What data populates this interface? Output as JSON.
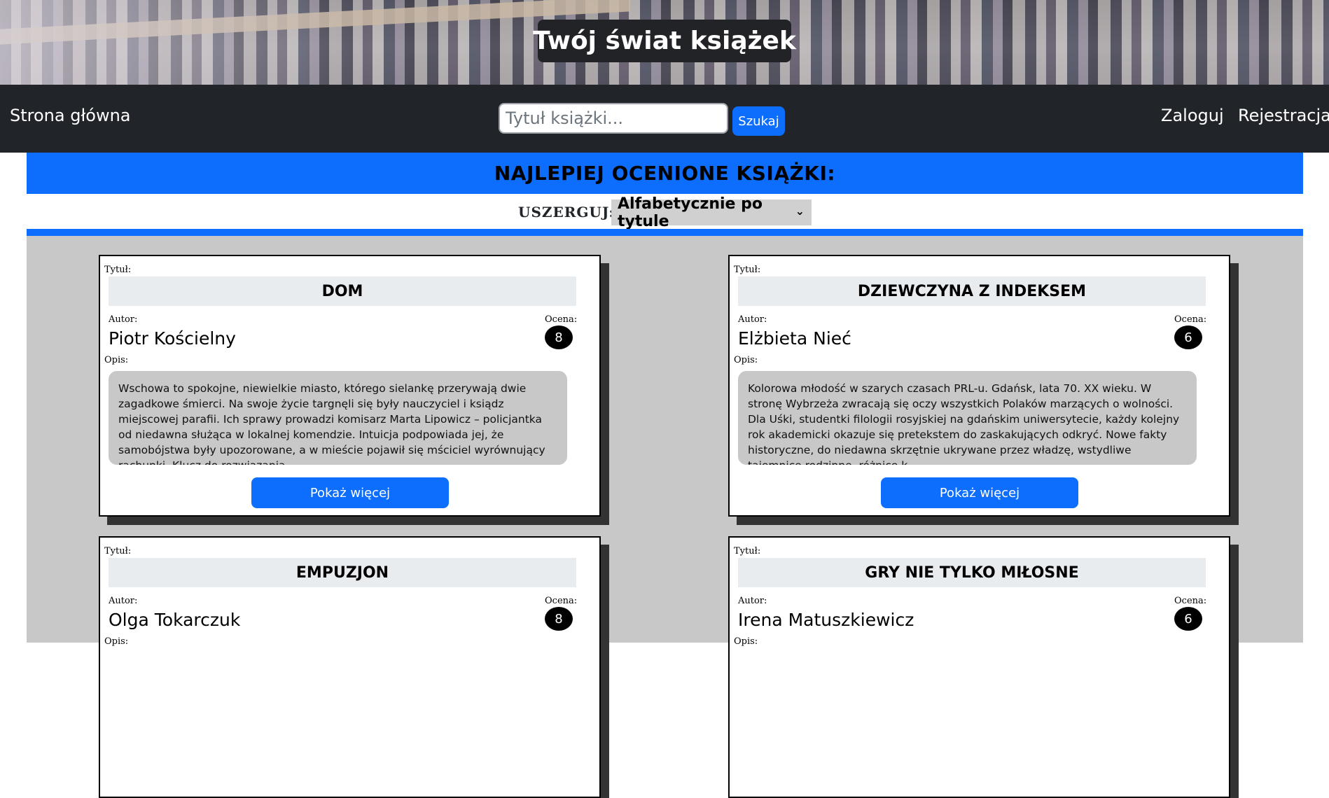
{
  "site": {
    "title": "Twój świat książek"
  },
  "nav": {
    "home": "Strona główna",
    "search_placeholder": "Tytuł książki...",
    "search_button": "Szukaj",
    "login": "Zaloguj",
    "register": "Rejestracja"
  },
  "main": {
    "heading": "NAJLEPIEJ OCENIONE KSIĄŻKI:",
    "sort_label": "USZERGUJ:",
    "sort_value": "Alfabetycznie po tytule"
  },
  "labels": {
    "title": "Tytuł:",
    "author": "Autor:",
    "rating": "Ocena:",
    "description": "Opis:",
    "more": "Pokaż więcej"
  },
  "books": [
    {
      "title": "DOM",
      "author": "Piotr Kościelny",
      "rating": "8",
      "description": "Wschowa to spokojne, niewielkie miasto, którego sielankę przerywają dwie zagadkowe śmierci. Na swoje życie targnęli się były nauczyciel i ksiądz miejscowej parafii. Ich sprawy prowadzi komisarz Marta Lipowicz – policjantka od niedawna służąca w lokalnej komendzie. Intuicja podpowiada jej, że samobójstwa były upozorowane, a w mieście pojawił się mściciel wyrównujący rachunki. Klucz do rozwiązania..."
    },
    {
      "title": "DZIEWCZYNA Z INDEKSEM",
      "author": "Elżbieta Nieć",
      "rating": "6",
      "description": "Kolorowa młodość w szarych czasach PRL-u. Gdańsk, lata 70. XX wieku. W stronę Wybrzeża zwracają się oczy wszystkich Polaków marzących o wolności. Dla Uśki, studentki filologii rosyjskiej na gdańskim uniwersytecie, każdy kolejny rok akademicki okazuje się pretekstem do zaskakujących odkryć. Nowe fakty historyczne, do niedawna skrzętnie ukrywane przez władzę, wstydliwe tajemnice rodzinne, różnice k..."
    },
    {
      "title": "EMPUZJON",
      "author": "Olga Tokarczuk",
      "rating": "8",
      "description": ""
    },
    {
      "title": "GRY NIE TYLKO MIŁOSNE",
      "author": "Irena Matuszkiewicz",
      "rating": "6",
      "description": ""
    }
  ]
}
